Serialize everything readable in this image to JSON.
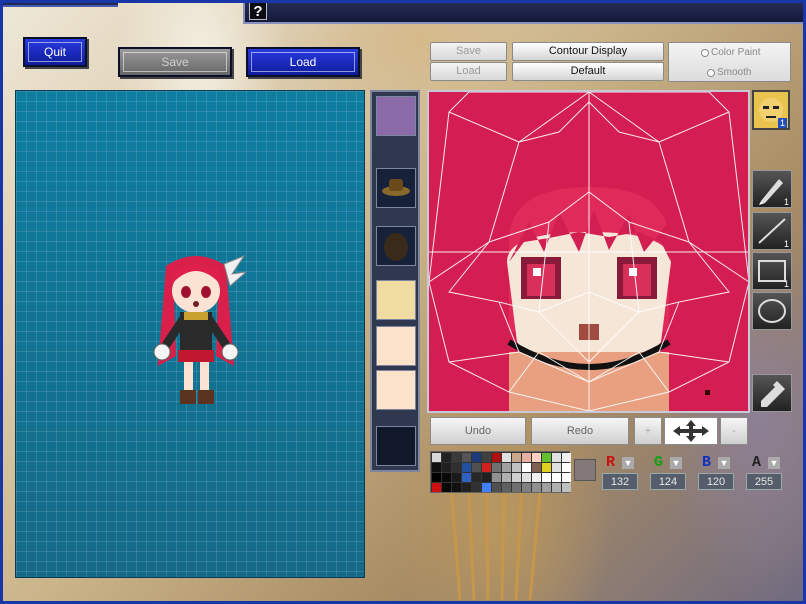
{
  "header": {
    "help_label": "?"
  },
  "main_buttons": {
    "quit": "Quit",
    "save": "Save",
    "load": "Load"
  },
  "editor_controls": {
    "save": "Save",
    "load": "Load",
    "contour_display": "Contour Display",
    "default": "Default",
    "color_paint": "Color Paint",
    "smooth": "Smooth"
  },
  "avatar_badge": "1",
  "tools": [
    {
      "name": "pen",
      "num": "1"
    },
    {
      "name": "line",
      "num": "1"
    },
    {
      "name": "rect",
      "num": "1"
    },
    {
      "name": "ellipse",
      "num": ""
    },
    {
      "name": "eyedropper",
      "num": ""
    }
  ],
  "undo_row": {
    "undo": "Undo",
    "redo": "Redo",
    "zoom_in": "+",
    "zoom_out": "-"
  },
  "color": {
    "r_label": "R",
    "g_label": "G",
    "b_label": "B",
    "a_label": "A",
    "r": "132",
    "g": "124",
    "b": "120",
    "a": "255",
    "current_hex": "#847878"
  },
  "palette": [
    "#d8d8d8",
    "#222222",
    "#3a3a3a",
    "#555555",
    "#1c3a7a",
    "#404040",
    "#b01010",
    "#e0e0e0",
    "#c8a888",
    "#e8b0a0",
    "#ffd0c0",
    "#60c030",
    "#e0e0e0",
    "#f0f0f0",
    "#101010",
    "#202020",
    "#303030",
    "#2050a0",
    "#505050",
    "#d02020",
    "#707070",
    "#a0a0a0",
    "#c0c0c0",
    "#ffffff",
    "#806050",
    "#e0d020",
    "#e0e0e0",
    "#ffffff",
    "#000000",
    "#0a0a0a",
    "#1a1a1a",
    "#3060c0",
    "#282828",
    "#202020",
    "#909090",
    "#b0b0b0",
    "#d0d0d0",
    "#e0e0e0",
    "#f0f0f0",
    "#ffffff",
    "#ffffff",
    "#ffffff",
    "#d01010",
    "#080808",
    "#101010",
    "#202020",
    "#303030",
    "#4080ff",
    "#505050",
    "#606060",
    "#707070",
    "#808080",
    "#909090",
    "#a0a0a0",
    "#b0b0b0",
    "#c0c0c0"
  ]
}
